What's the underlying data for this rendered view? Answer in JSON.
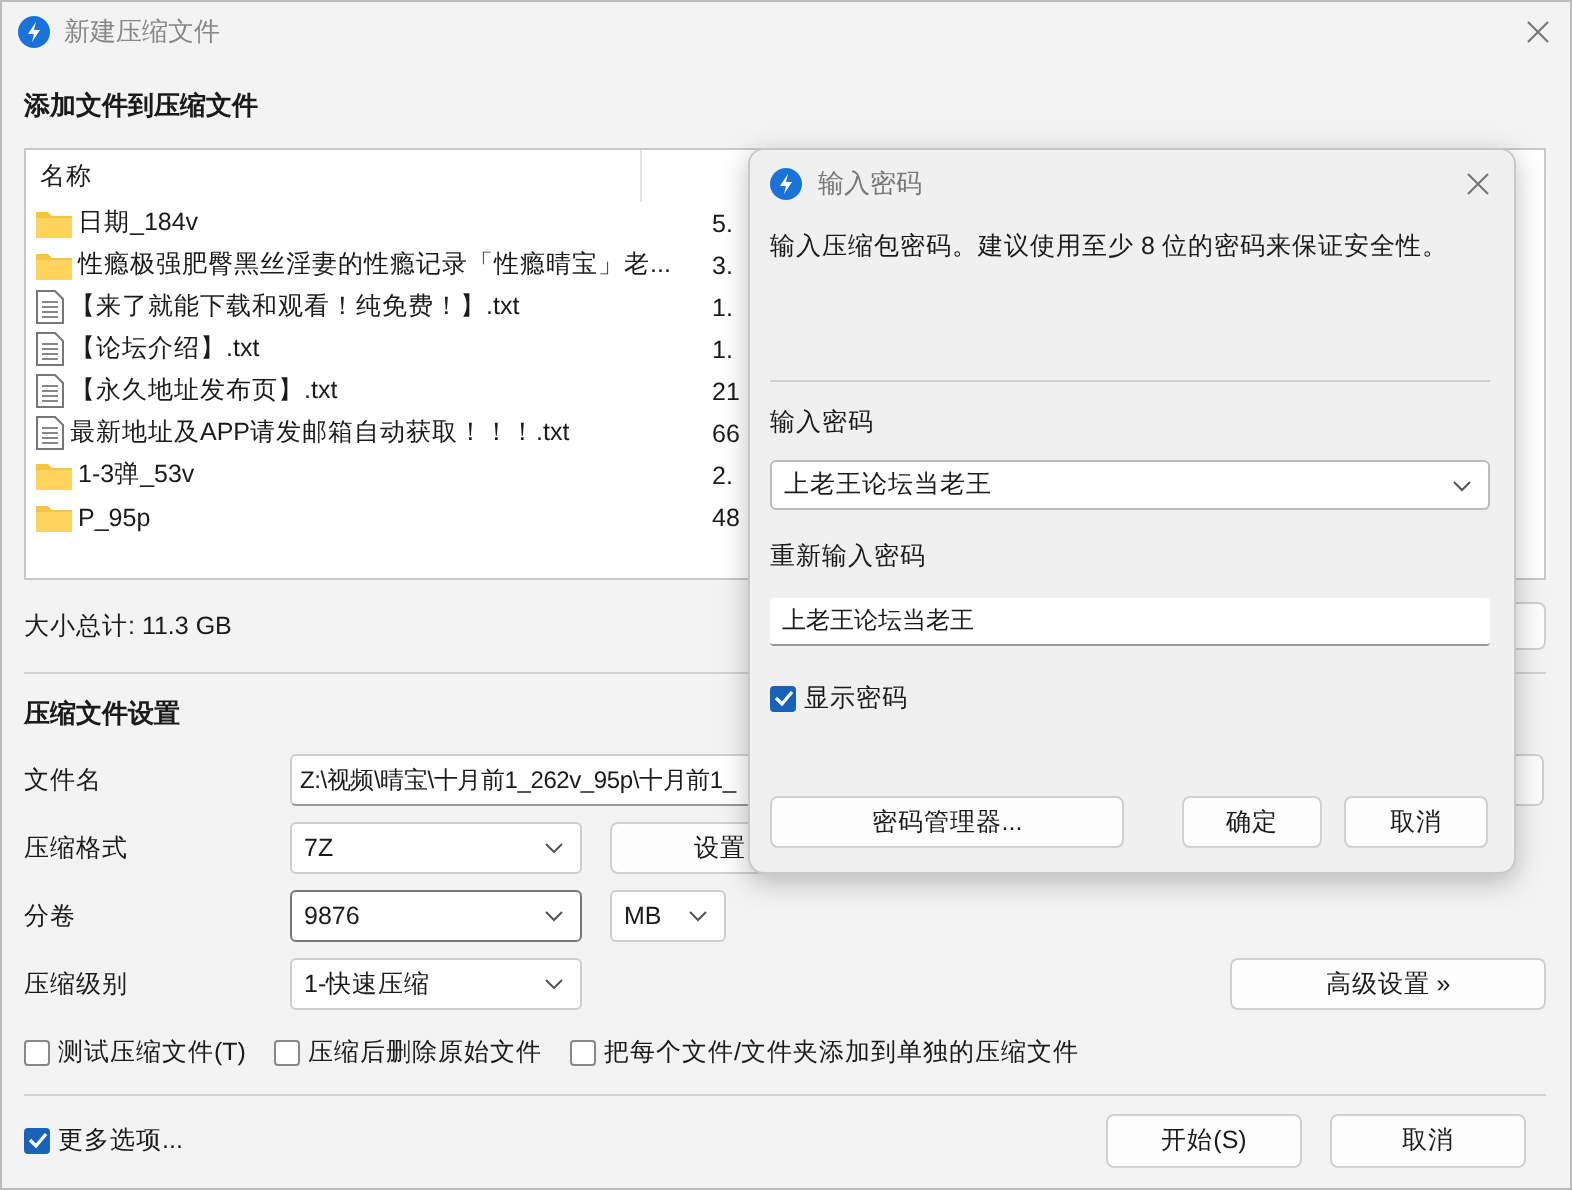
{
  "window": {
    "title": "新建压缩文件"
  },
  "heading": "添加文件到压缩文件",
  "file_list": {
    "columns": [
      "名称"
    ],
    "rows": [
      {
        "kind": "folder",
        "name": "日期_184v",
        "size": "5."
      },
      {
        "kind": "folder",
        "name": "性瘾极强肥臀黑丝淫妻的性瘾记录「性瘾晴宝」老...",
        "size": "3."
      },
      {
        "kind": "file",
        "name": "【来了就能下载和观看！纯免费！】.txt",
        "size": "1."
      },
      {
        "kind": "file",
        "name": "【论坛介绍】.txt",
        "size": "1."
      },
      {
        "kind": "file",
        "name": "【永久地址发布页】.txt",
        "size": "21"
      },
      {
        "kind": "file",
        "name": "最新地址及APP请发邮箱自动获取！！！.txt",
        "size": "66"
      },
      {
        "kind": "folder",
        "name": "1-3弹_53v",
        "size": "2."
      },
      {
        "kind": "folder",
        "name": "P_95p",
        "size": "48"
      }
    ]
  },
  "total": "大小总计: 11.3 GB",
  "settings": {
    "heading": "压缩文件设置",
    "filename": {
      "label": "文件名",
      "value": "Z:\\视频\\晴宝\\十月前1_262v_95p\\十月前1_"
    },
    "format": {
      "label": "压缩格式",
      "value": "7Z",
      "button": "设置"
    },
    "volume": {
      "label": "分卷",
      "value": "9876",
      "unit": "MB"
    },
    "level": {
      "label": "压缩级别",
      "value": "1-快速压缩",
      "button": "高级设置 »"
    },
    "options": [
      {
        "label": "测试压缩文件(T)",
        "checked": false
      },
      {
        "label": "压缩后删除原始文件",
        "checked": false
      },
      {
        "label": "把每个文件/文件夹添加到单独的压缩文件",
        "checked": false
      }
    ]
  },
  "footer": {
    "more": {
      "label": "更多选项...",
      "checked": true
    },
    "buttons": [
      "开始(S)",
      "取消"
    ]
  },
  "password_dialog": {
    "title": "输入密码",
    "message": "输入压缩包密码。建议使用至少 8 位的密码来保证安全性。",
    "password_label": "输入密码",
    "password": "上老王论坛当老王",
    "confirm_label": "重新输入密码",
    "confirm": "上老王论坛当老王",
    "show_password": {
      "label": "显示密码",
      "checked": true
    },
    "buttons": [
      "密码管理器...",
      "确定",
      "取消"
    ]
  }
}
